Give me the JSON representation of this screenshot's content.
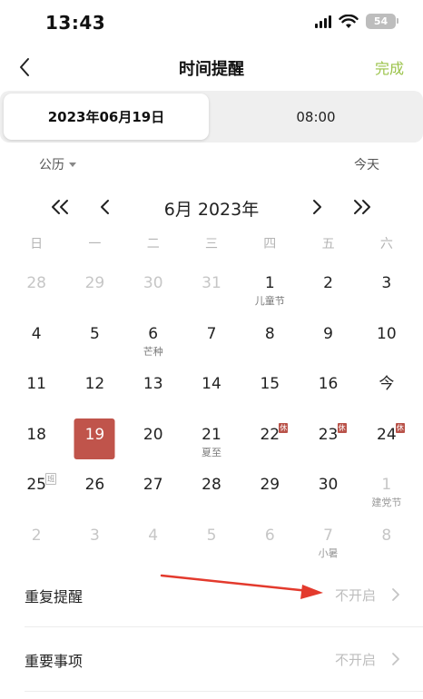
{
  "status_bar": {
    "time": "13:43",
    "battery": "54"
  },
  "nav": {
    "title": "时间提醒",
    "done_label": "完成"
  },
  "segment": {
    "date_label": "2023年06月19日",
    "time_label": "08:00"
  },
  "calendar_type": {
    "label": "公历",
    "today_label": "今天"
  },
  "month_nav": {
    "title": "6月 2023年"
  },
  "weekdays": [
    "日",
    "一",
    "二",
    "三",
    "四",
    "五",
    "六"
  ],
  "days": [
    {
      "n": "28",
      "other": true
    },
    {
      "n": "29",
      "other": true
    },
    {
      "n": "30",
      "other": true
    },
    {
      "n": "31",
      "other": true
    },
    {
      "n": "1",
      "sub": "儿童节"
    },
    {
      "n": "2"
    },
    {
      "n": "3"
    },
    {
      "n": "4"
    },
    {
      "n": "5"
    },
    {
      "n": "6",
      "sub": "芒种"
    },
    {
      "n": "7"
    },
    {
      "n": "8"
    },
    {
      "n": "9"
    },
    {
      "n": "10"
    },
    {
      "n": "11"
    },
    {
      "n": "12"
    },
    {
      "n": "13"
    },
    {
      "n": "14"
    },
    {
      "n": "15"
    },
    {
      "n": "16"
    },
    {
      "n": "今"
    },
    {
      "n": "18"
    },
    {
      "n": "19",
      "selected": true
    },
    {
      "n": "20"
    },
    {
      "n": "21",
      "sub": "夏至"
    },
    {
      "n": "22",
      "badge": "休"
    },
    {
      "n": "23",
      "badge": "休"
    },
    {
      "n": "24",
      "badge": "休"
    },
    {
      "n": "25",
      "badge": "班",
      "work": true
    },
    {
      "n": "26"
    },
    {
      "n": "27"
    },
    {
      "n": "28"
    },
    {
      "n": "29"
    },
    {
      "n": "30"
    },
    {
      "n": "1",
      "other": true,
      "sub": "建党节"
    },
    {
      "n": "2",
      "other": true
    },
    {
      "n": "3",
      "other": true
    },
    {
      "n": "4",
      "other": true
    },
    {
      "n": "5",
      "other": true
    },
    {
      "n": "6",
      "other": true
    },
    {
      "n": "7",
      "other": true,
      "sub": "小暑"
    },
    {
      "n": "8",
      "other": true
    }
  ],
  "settings": [
    {
      "label": "重复提醒",
      "value": "不开启"
    },
    {
      "label": "重要事项",
      "value": "不开启"
    }
  ],
  "colors": {
    "accent_done": "#9bc34a",
    "selected_day": "#c0544b",
    "arrow": "#e33a2d"
  }
}
